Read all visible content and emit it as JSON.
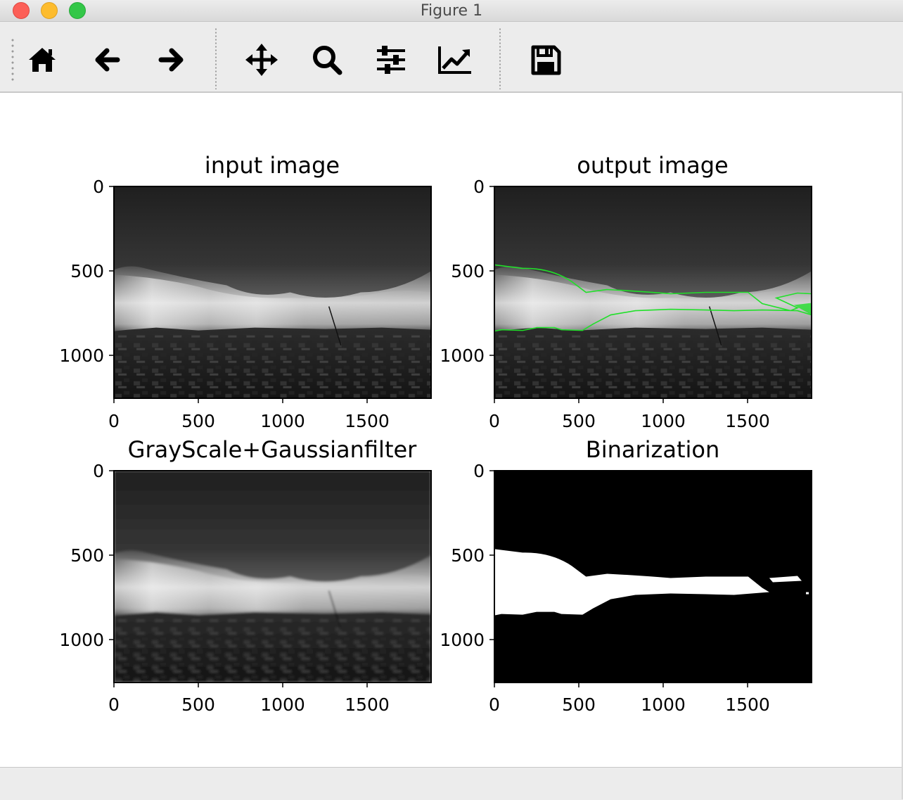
{
  "window": {
    "title": "Figure 1"
  },
  "toolbar": {
    "tools": [
      {
        "name": "home-button",
        "icon": "home-icon"
      },
      {
        "name": "back-button",
        "icon": "arrow-left-icon"
      },
      {
        "name": "forward-button",
        "icon": "arrow-right-icon"
      },
      {
        "name": "pan-button",
        "icon": "move-arrows-icon"
      },
      {
        "name": "zoom-button",
        "icon": "magnifier-icon"
      },
      {
        "name": "subplots-button",
        "icon": "sliders-icon"
      },
      {
        "name": "axes-edit-button",
        "icon": "line-chart-icon"
      },
      {
        "name": "save-button",
        "icon": "floppy-disk-icon"
      }
    ]
  },
  "chart_data": [
    {
      "type": "image",
      "title": "input image",
      "xlim": [
        0,
        1880
      ],
      "ylim": [
        1250,
        0
      ],
      "xticks": [
        "0",
        "500",
        "1000",
        "1500"
      ],
      "yticks": [
        "0",
        "500",
        "1000"
      ],
      "content": "grayscale cityscape photo with clouds and sunbeams"
    },
    {
      "type": "image",
      "title": "output image",
      "xlim": [
        0,
        1880
      ],
      "ylim": [
        1250,
        0
      ],
      "xticks": [
        "0",
        "500",
        "1000",
        "1500"
      ],
      "yticks": [
        "0",
        "500",
        "1000"
      ],
      "content": "same photo with green contour outlining bright sky region",
      "contour_color": "#21e02a"
    },
    {
      "type": "image",
      "title": "GrayScale+Gaussianfilter",
      "xlim": [
        0,
        1880
      ],
      "ylim": [
        1250,
        0
      ],
      "xticks": [
        "0",
        "500",
        "1000",
        "1500"
      ],
      "yticks": [
        "0",
        "500",
        "1000"
      ],
      "content": "blurred grayscale photo"
    },
    {
      "type": "image",
      "title": "Binarization",
      "xlim": [
        0,
        1880
      ],
      "ylim": [
        1250,
        0
      ],
      "xticks": [
        "0",
        "500",
        "1000",
        "1500"
      ],
      "yticks": [
        "0",
        "500",
        "1000"
      ],
      "content": "black background with white region where bright sky was"
    }
  ]
}
